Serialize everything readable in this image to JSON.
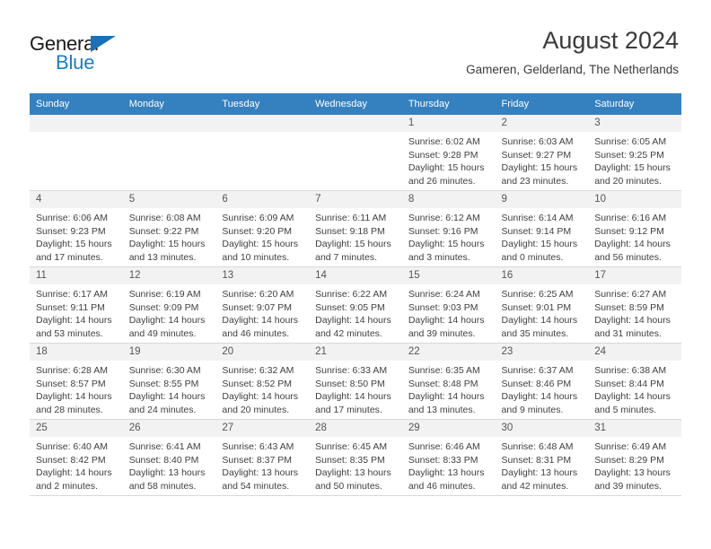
{
  "brand": {
    "name_part1": "General",
    "name_part2": "Blue",
    "accent_color": "#1c7cc4"
  },
  "header": {
    "title": "August 2024",
    "subtitle": "Gameren, Gelderland, The Netherlands"
  },
  "theme": {
    "header_row_color": "#3580bf",
    "daynum_band_color": "#f2f2f2",
    "grid_line_color": "#d8d8d8"
  },
  "weekdays": [
    "Sunday",
    "Monday",
    "Tuesday",
    "Wednesday",
    "Thursday",
    "Friday",
    "Saturday"
  ],
  "weeks": [
    [
      {
        "day": "",
        "empty": true,
        "sunrise": "",
        "sunset": "",
        "daylight_line1": "",
        "daylight_line2": ""
      },
      {
        "day": "",
        "empty": true,
        "sunrise": "",
        "sunset": "",
        "daylight_line1": "",
        "daylight_line2": ""
      },
      {
        "day": "",
        "empty": true,
        "sunrise": "",
        "sunset": "",
        "daylight_line1": "",
        "daylight_line2": ""
      },
      {
        "day": "",
        "empty": true,
        "sunrise": "",
        "sunset": "",
        "daylight_line1": "",
        "daylight_line2": ""
      },
      {
        "day": "1",
        "empty": false,
        "sunrise": "Sunrise: 6:02 AM",
        "sunset": "Sunset: 9:28 PM",
        "daylight_line1": "Daylight: 15 hours",
        "daylight_line2": "and 26 minutes."
      },
      {
        "day": "2",
        "empty": false,
        "sunrise": "Sunrise: 6:03 AM",
        "sunset": "Sunset: 9:27 PM",
        "daylight_line1": "Daylight: 15 hours",
        "daylight_line2": "and 23 minutes."
      },
      {
        "day": "3",
        "empty": false,
        "sunrise": "Sunrise: 6:05 AM",
        "sunset": "Sunset: 9:25 PM",
        "daylight_line1": "Daylight: 15 hours",
        "daylight_line2": "and 20 minutes."
      }
    ],
    [
      {
        "day": "4",
        "empty": false,
        "sunrise": "Sunrise: 6:06 AM",
        "sunset": "Sunset: 9:23 PM",
        "daylight_line1": "Daylight: 15 hours",
        "daylight_line2": "and 17 minutes."
      },
      {
        "day": "5",
        "empty": false,
        "sunrise": "Sunrise: 6:08 AM",
        "sunset": "Sunset: 9:22 PM",
        "daylight_line1": "Daylight: 15 hours",
        "daylight_line2": "and 13 minutes."
      },
      {
        "day": "6",
        "empty": false,
        "sunrise": "Sunrise: 6:09 AM",
        "sunset": "Sunset: 9:20 PM",
        "daylight_line1": "Daylight: 15 hours",
        "daylight_line2": "and 10 minutes."
      },
      {
        "day": "7",
        "empty": false,
        "sunrise": "Sunrise: 6:11 AM",
        "sunset": "Sunset: 9:18 PM",
        "daylight_line1": "Daylight: 15 hours",
        "daylight_line2": "and 7 minutes."
      },
      {
        "day": "8",
        "empty": false,
        "sunrise": "Sunrise: 6:12 AM",
        "sunset": "Sunset: 9:16 PM",
        "daylight_line1": "Daylight: 15 hours",
        "daylight_line2": "and 3 minutes."
      },
      {
        "day": "9",
        "empty": false,
        "sunrise": "Sunrise: 6:14 AM",
        "sunset": "Sunset: 9:14 PM",
        "daylight_line1": "Daylight: 15 hours",
        "daylight_line2": "and 0 minutes."
      },
      {
        "day": "10",
        "empty": false,
        "sunrise": "Sunrise: 6:16 AM",
        "sunset": "Sunset: 9:12 PM",
        "daylight_line1": "Daylight: 14 hours",
        "daylight_line2": "and 56 minutes."
      }
    ],
    [
      {
        "day": "11",
        "empty": false,
        "sunrise": "Sunrise: 6:17 AM",
        "sunset": "Sunset: 9:11 PM",
        "daylight_line1": "Daylight: 14 hours",
        "daylight_line2": "and 53 minutes."
      },
      {
        "day": "12",
        "empty": false,
        "sunrise": "Sunrise: 6:19 AM",
        "sunset": "Sunset: 9:09 PM",
        "daylight_line1": "Daylight: 14 hours",
        "daylight_line2": "and 49 minutes."
      },
      {
        "day": "13",
        "empty": false,
        "sunrise": "Sunrise: 6:20 AM",
        "sunset": "Sunset: 9:07 PM",
        "daylight_line1": "Daylight: 14 hours",
        "daylight_line2": "and 46 minutes."
      },
      {
        "day": "14",
        "empty": false,
        "sunrise": "Sunrise: 6:22 AM",
        "sunset": "Sunset: 9:05 PM",
        "daylight_line1": "Daylight: 14 hours",
        "daylight_line2": "and 42 minutes."
      },
      {
        "day": "15",
        "empty": false,
        "sunrise": "Sunrise: 6:24 AM",
        "sunset": "Sunset: 9:03 PM",
        "daylight_line1": "Daylight: 14 hours",
        "daylight_line2": "and 39 minutes."
      },
      {
        "day": "16",
        "empty": false,
        "sunrise": "Sunrise: 6:25 AM",
        "sunset": "Sunset: 9:01 PM",
        "daylight_line1": "Daylight: 14 hours",
        "daylight_line2": "and 35 minutes."
      },
      {
        "day": "17",
        "empty": false,
        "sunrise": "Sunrise: 6:27 AM",
        "sunset": "Sunset: 8:59 PM",
        "daylight_line1": "Daylight: 14 hours",
        "daylight_line2": "and 31 minutes."
      }
    ],
    [
      {
        "day": "18",
        "empty": false,
        "sunrise": "Sunrise: 6:28 AM",
        "sunset": "Sunset: 8:57 PM",
        "daylight_line1": "Daylight: 14 hours",
        "daylight_line2": "and 28 minutes."
      },
      {
        "day": "19",
        "empty": false,
        "sunrise": "Sunrise: 6:30 AM",
        "sunset": "Sunset: 8:55 PM",
        "daylight_line1": "Daylight: 14 hours",
        "daylight_line2": "and 24 minutes."
      },
      {
        "day": "20",
        "empty": false,
        "sunrise": "Sunrise: 6:32 AM",
        "sunset": "Sunset: 8:52 PM",
        "daylight_line1": "Daylight: 14 hours",
        "daylight_line2": "and 20 minutes."
      },
      {
        "day": "21",
        "empty": false,
        "sunrise": "Sunrise: 6:33 AM",
        "sunset": "Sunset: 8:50 PM",
        "daylight_line1": "Daylight: 14 hours",
        "daylight_line2": "and 17 minutes."
      },
      {
        "day": "22",
        "empty": false,
        "sunrise": "Sunrise: 6:35 AM",
        "sunset": "Sunset: 8:48 PM",
        "daylight_line1": "Daylight: 14 hours",
        "daylight_line2": "and 13 minutes."
      },
      {
        "day": "23",
        "empty": false,
        "sunrise": "Sunrise: 6:37 AM",
        "sunset": "Sunset: 8:46 PM",
        "daylight_line1": "Daylight: 14 hours",
        "daylight_line2": "and 9 minutes."
      },
      {
        "day": "24",
        "empty": false,
        "sunrise": "Sunrise: 6:38 AM",
        "sunset": "Sunset: 8:44 PM",
        "daylight_line1": "Daylight: 14 hours",
        "daylight_line2": "and 5 minutes."
      }
    ],
    [
      {
        "day": "25",
        "empty": false,
        "sunrise": "Sunrise: 6:40 AM",
        "sunset": "Sunset: 8:42 PM",
        "daylight_line1": "Daylight: 14 hours",
        "daylight_line2": "and 2 minutes."
      },
      {
        "day": "26",
        "empty": false,
        "sunrise": "Sunrise: 6:41 AM",
        "sunset": "Sunset: 8:40 PM",
        "daylight_line1": "Daylight: 13 hours",
        "daylight_line2": "and 58 minutes."
      },
      {
        "day": "27",
        "empty": false,
        "sunrise": "Sunrise: 6:43 AM",
        "sunset": "Sunset: 8:37 PM",
        "daylight_line1": "Daylight: 13 hours",
        "daylight_line2": "and 54 minutes."
      },
      {
        "day": "28",
        "empty": false,
        "sunrise": "Sunrise: 6:45 AM",
        "sunset": "Sunset: 8:35 PM",
        "daylight_line1": "Daylight: 13 hours",
        "daylight_line2": "and 50 minutes."
      },
      {
        "day": "29",
        "empty": false,
        "sunrise": "Sunrise: 6:46 AM",
        "sunset": "Sunset: 8:33 PM",
        "daylight_line1": "Daylight: 13 hours",
        "daylight_line2": "and 46 minutes."
      },
      {
        "day": "30",
        "empty": false,
        "sunrise": "Sunrise: 6:48 AM",
        "sunset": "Sunset: 8:31 PM",
        "daylight_line1": "Daylight: 13 hours",
        "daylight_line2": "and 42 minutes."
      },
      {
        "day": "31",
        "empty": false,
        "sunrise": "Sunrise: 6:49 AM",
        "sunset": "Sunset: 8:29 PM",
        "daylight_line1": "Daylight: 13 hours",
        "daylight_line2": "and 39 minutes."
      }
    ]
  ]
}
